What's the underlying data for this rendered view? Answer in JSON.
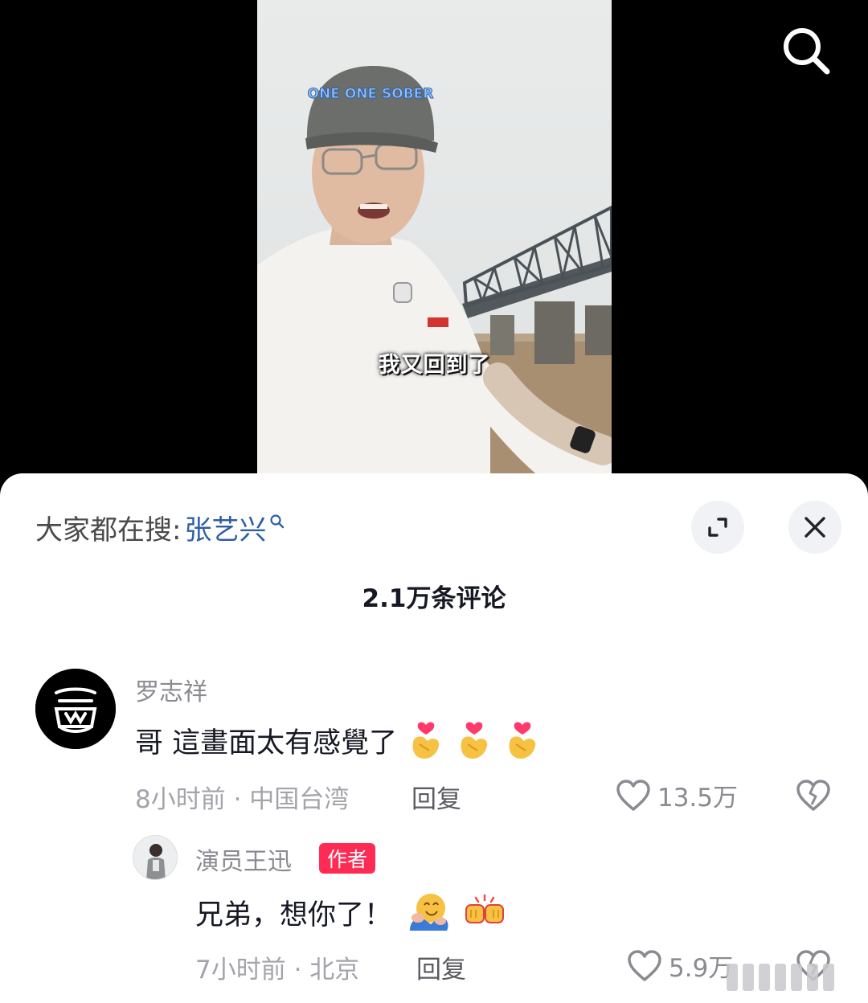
{
  "video": {
    "subtitle": "我又回到了",
    "cap_text": "ONE ONE SOBER"
  },
  "panel": {
    "trending_prefix": "大家都在搜:",
    "trending_term": "张艺兴",
    "comment_count": "2.1万条评论"
  },
  "comments": [
    {
      "username": "罗志祥",
      "text": "哥 這畫面太有感覺了",
      "emojis": [
        "heart-hands-emoji",
        "heart-hands-emoji",
        "heart-hands-emoji"
      ],
      "meta": "8小时前 · 中国台湾",
      "reply_label": "回复",
      "likes": "13.5万"
    }
  ],
  "replies": [
    {
      "username": "演员王迅",
      "badge": "作者",
      "text": "兄弟，想你了！",
      "emojis": [
        "hugging-face-emoji",
        "fist-bump-emoji"
      ],
      "meta": "7小时前 · 北京",
      "reply_label": "回复",
      "likes": "5.9万"
    }
  ],
  "colors": {
    "trending_term": "#2e5fa6",
    "author_badge": "#fe2c55",
    "panel_bg": "#ffffff"
  }
}
